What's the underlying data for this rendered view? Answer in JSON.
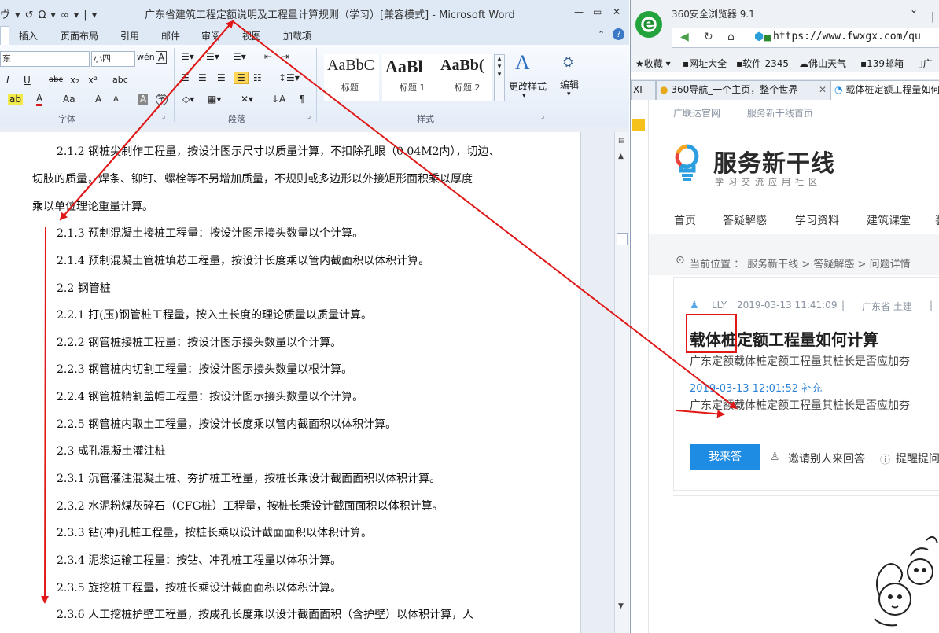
{
  "word": {
    "qat": [
      "ヴ",
      "▾",
      "↺",
      "Ω",
      "▾",
      "∞",
      "▾",
      "|",
      "▾"
    ],
    "title": "广东省建筑工程定额说明及工程量计算规则（学习）[兼容模式] - Microsoft Word",
    "window_buttons": [
      "—",
      "▭",
      "✕"
    ],
    "tabs": [
      "插入",
      "页面布局",
      "引用",
      "邮件",
      "审阅",
      "视图",
      "加载项"
    ],
    "help": "?",
    "ribbon": {
      "font_name_value": "东",
      "font_size_value": "小四",
      "font_group_label": "字体",
      "paragraph_group_label": "段落",
      "styles_group_label": "样式",
      "styles": [
        {
          "sample": "AaBbC",
          "name": "标题"
        },
        {
          "sample": "AaBl",
          "name": "标题 1"
        },
        {
          "sample": "AaBb(",
          "name": "标题 2"
        }
      ],
      "change_styles_label": "更改样式",
      "edit_label": "编辑",
      "font_buttons": [
        "I",
        "U",
        "abc",
        "x₂",
        "x²",
        "A",
        "Aa",
        "A",
        "A",
        "A"
      ],
      "color_accent": "#d6181f"
    },
    "doc_lines": [
      "2.1.2 钢桩尖制作工程量，按设计图示尺寸以质量计算，不扣除孔眼（0.04M2内），切边、",
      "切肢的质量，焊条、铆钉、螺栓等不另增加质量，不规则或多边形以外接矩形面积乘以厚度",
      "乘以单位理论重量计算。",
      "2.1.3 预制混凝土接桩工程量：按设计图示接头数量以个计算。",
      "2.1.4 预制混凝土管桩填芯工程量，按设计长度乘以管内截面积以体积计算。",
      "2.2 钢管桩",
      "2.2.1 打(压)钢管桩工程量，按入土长度的理论质量以质量计算。",
      "2.2.2 钢管桩接桩工程量：按设计图示接头数量以个计算。",
      "2.2.3 钢管桩内切割工程量：按设计图示接头数量以根计算。",
      "2.2.4  钢管桩精割盖帽工程量：按设计图示接头数量以个计算。",
      "2.2.5 钢管桩内取土工程量，按设计长度乘以管内截面积以体积计算。",
      "2.3 成孔混凝土灌注桩",
      "2.3.1 沉管灌注混凝土桩、夯扩桩工程量，按桩长乘设计截面面积以体积计算。",
      "2.3.2 水泥粉煤灰碎石（CFG桩）工程量，按桩长乘设计截面面积以体积计算。",
      "2.3.3 钻(冲)孔桩工程量，按桩长乘以设计截面面积以体积计算。",
      "2.3.4 泥浆运输工程量：按钻、冲孔桩工程量以体积计算。",
      "2.3.5  旋挖桩工程量，按桩长乘设计截面面积以体积计算。",
      "2.3.6 人工挖桩护壁工程量，按成孔长度乘以设计截面面积（含护壁）以体积计算，人"
    ]
  },
  "browser": {
    "logo_letter": "e",
    "title": "360安全浏览器 9.1",
    "url_host": "https://www.fwxgx.com/qu",
    "nav": [
      "◀",
      "↻",
      "⌂"
    ],
    "bookmarks": [
      "收藏",
      "网址大全",
      "软件-2345",
      "佛山天气",
      "139邮箱",
      "广"
    ],
    "tabs": [
      {
        "label": "XI"
      },
      {
        "label": "360导航_一个主页，整个世界"
      },
      {
        "label": "载体桩定额工程量如何"
      }
    ],
    "tab_close": "✕",
    "site": {
      "top_links": [
        "广联达官网",
        "服务新干线首页"
      ],
      "name": "服务新干线",
      "slogan": "学习交流应用社区",
      "nav": [
        "首页",
        "答疑解惑",
        "学习资料",
        "建筑课堂",
        "装"
      ],
      "crumb": "当前位置 ： 服务新干线 > 答疑解惑 > 问题详情",
      "question": {
        "user": "LLY",
        "time": "2019-03-13 11:41:09",
        "sep": "|",
        "region": "广东省  土建",
        "sep2": "|",
        "title": "载体桩定额工程量如何计算",
        "text": "广东定额载体桩定额工程量其桩长是否应加夯",
        "supplement_time": "2019-03-13 12:01:52 补充",
        "supplement_text": "广东定额载体桩定额工程量其桩长是否应加夯",
        "answer_button": "我来答",
        "invite": "邀请别人来回答",
        "remind": "提醒提问"
      },
      "brand_color": "#1f8ce4"
    }
  }
}
